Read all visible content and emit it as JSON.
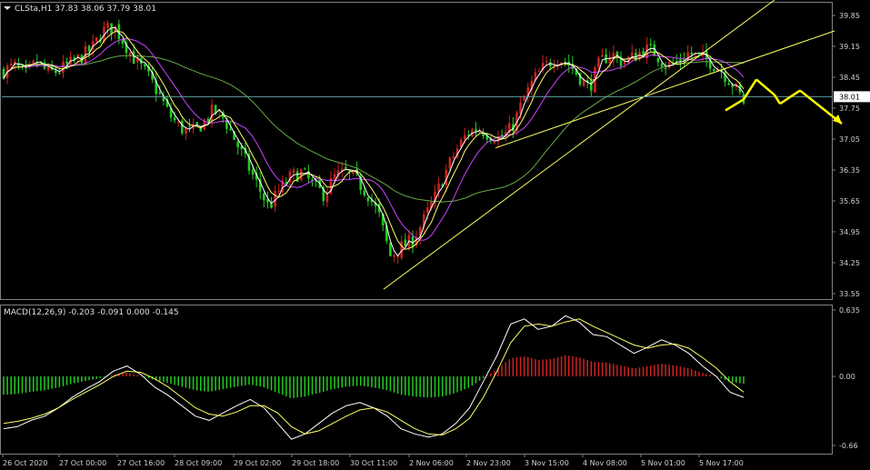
{
  "chart_data": [
    {
      "type": "candlestick",
      "title": "CLSta,H1  37.83 38.06 37.79 38.01",
      "ylim": [
        33.55,
        39.85
      ],
      "yticks": [
        "39.85",
        "39.15",
        "38.45",
        "37.75",
        "37.05",
        "36.35",
        "35.65",
        "34.95",
        "34.25",
        "33.55"
      ],
      "last_price": "38.01",
      "colors": {
        "up": "#cc2222",
        "down": "#22cc22",
        "ma_fast": "#ffffff",
        "ma_mid": "#ffff66",
        "ma_slow": "#cc44ff",
        "ma_long": "#66aa44",
        "trend": "#ffff66",
        "arrow": "#ffff00",
        "hline": "#5f9ea0"
      },
      "price_path": [
        38.6,
        38.7,
        38.5,
        38.8,
        38.55,
        38.6,
        38.75,
        38.9,
        39.1,
        39.5,
        39.6,
        39.2,
        38.8,
        38.5,
        38.1,
        37.6,
        37.3,
        37.2,
        37.4,
        37.7,
        37.5,
        37.0,
        36.5,
        36.0,
        35.5,
        35.9,
        36.2,
        36.3,
        36.0,
        35.8,
        36.2,
        36.3,
        36.1,
        35.8,
        35.3,
        34.4,
        34.6,
        34.75,
        35.2,
        35.7,
        36.3,
        36.8,
        37.2,
        37.3,
        37.15,
        37.05,
        37.3,
        37.9,
        38.4,
        38.7,
        38.9,
        38.8,
        38.5,
        38.2,
        38.8,
        39.0,
        38.8,
        38.9,
        39.1,
        39.0,
        38.7,
        38.8,
        39.0,
        38.9,
        38.8,
        38.6,
        38.3,
        37.9
      ],
      "forecast_path": [
        [
          37.7,
          37.95,
          38.4,
          38.05,
          37.85,
          38.15,
          37.4
        ]
      ],
      "macd_label": "MACD(12,26,9) -0.203 -0.091 0.000 -0.145",
      "macd_ylim": [
        -0.66,
        0.635
      ],
      "macd_yticks": [
        "0.635",
        "0.00",
        "-0.66"
      ],
      "macd_main": [
        -0.5,
        -0.48,
        -0.42,
        -0.38,
        -0.3,
        -0.2,
        -0.12,
        -0.05,
        0.05,
        0.1,
        0.02,
        -0.1,
        -0.18,
        -0.28,
        -0.38,
        -0.42,
        -0.35,
        -0.28,
        -0.22,
        -0.3,
        -0.45,
        -0.6,
        -0.55,
        -0.45,
        -0.35,
        -0.28,
        -0.25,
        -0.3,
        -0.38,
        -0.5,
        -0.55,
        -0.58,
        -0.55,
        -0.45,
        -0.3,
        -0.05,
        0.2,
        0.5,
        0.55,
        0.45,
        0.48,
        0.58,
        0.52,
        0.4,
        0.38,
        0.3,
        0.22,
        0.28,
        0.35,
        0.3,
        0.22,
        0.1,
        0.0,
        -0.15,
        -0.2
      ],
      "macd_signal": [
        -0.45,
        -0.43,
        -0.4,
        -0.36,
        -0.3,
        -0.22,
        -0.15,
        -0.08,
        0.0,
        0.05,
        0.04,
        -0.02,
        -0.1,
        -0.2,
        -0.3,
        -0.36,
        -0.38,
        -0.34,
        -0.28,
        -0.28,
        -0.35,
        -0.48,
        -0.55,
        -0.52,
        -0.45,
        -0.38,
        -0.32,
        -0.3,
        -0.34,
        -0.42,
        -0.5,
        -0.55,
        -0.56,
        -0.5,
        -0.4,
        -0.2,
        0.05,
        0.32,
        0.48,
        0.5,
        0.48,
        0.52,
        0.55,
        0.48,
        0.42,
        0.36,
        0.3,
        0.27,
        0.3,
        0.31,
        0.27,
        0.18,
        0.08,
        -0.05,
        -0.15
      ],
      "xticks": [
        "26 Oct 2020",
        "27 Oct 00:00",
        "27 Oct 16:00",
        "28 Oct 09:00",
        "29 Oct 02:00",
        "29 Oct 18:00",
        "30 Oct 11:00",
        "2 Nov 06:00",
        "2 Nov 23:00",
        "3 Nov 15:00",
        "4 Nov 08:00",
        "5 Nov 01:00",
        "5 Nov 17:00"
      ]
    }
  ]
}
